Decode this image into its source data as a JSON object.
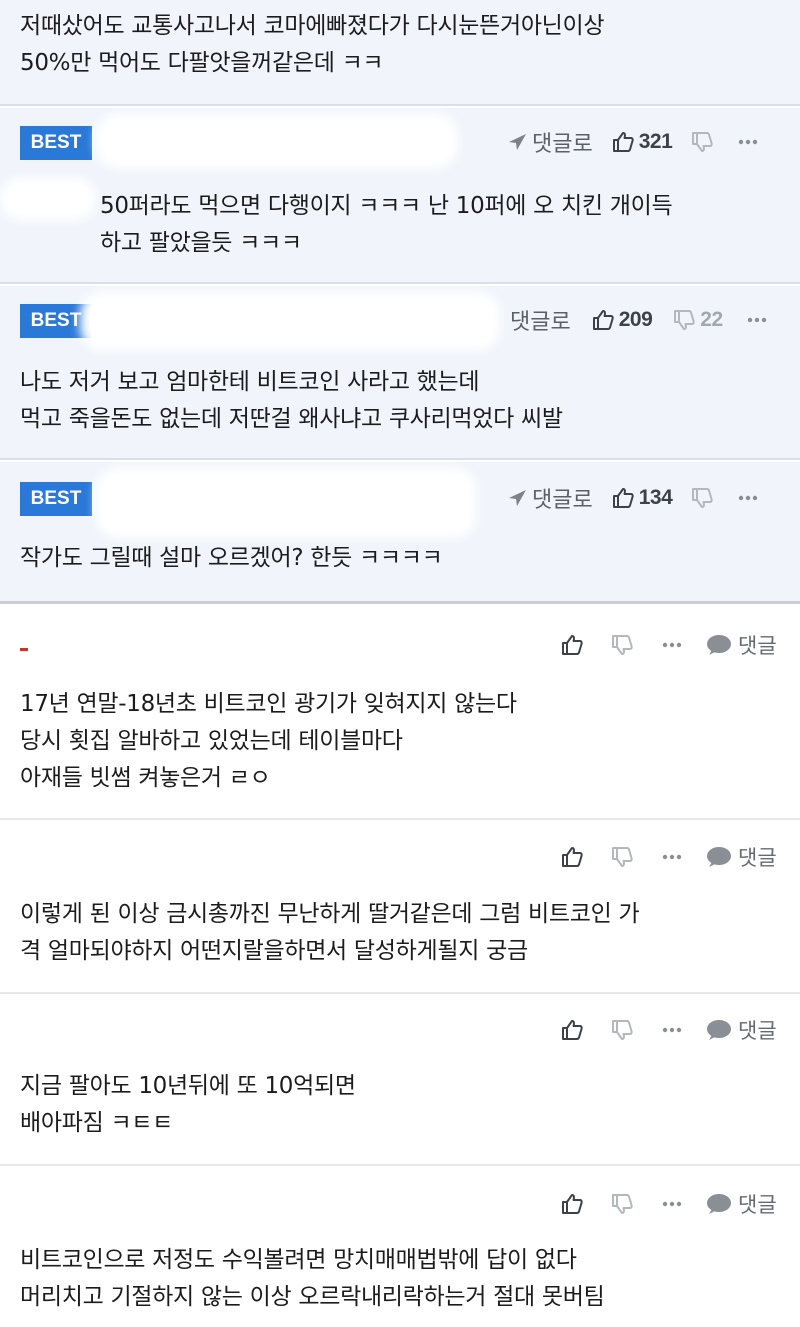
{
  "top_comment": {
    "text": "저때샀어도 교통사고나서 코마에빠졌다가 다시눈뜬거아닌이상\n50%만 먹어도 다팔앗을꺼같은데 ㅋㅋ"
  },
  "best_comments": [
    {
      "badge": "BEST",
      "reply_label": "댓글로",
      "likes": "321",
      "dislikes": "",
      "text": "50퍼라도 먹으면 다행이지 ㅋㅋㅋ 난 10퍼에 오 치킨 개이득\n하고 팔았을듯 ㅋㅋㅋ"
    },
    {
      "badge": "BEST",
      "reply_label": "댓글로",
      "likes": "209",
      "dislikes": "22",
      "text": "나도 저거 보고 엄마한테 비트코인 사라고 했는데\n먹고 죽을돈도 없는데 저딴걸 왜사냐고 쿠사리먹었다 씨발"
    },
    {
      "badge": "BEST",
      "reply_label": "댓글로",
      "likes": "134",
      "dislikes": "",
      "text": "작가도 그릴때 설마 오르겠어? 한듯 ㅋㅋㅋㅋ"
    }
  ],
  "comments": [
    {
      "reply_label": "댓글",
      "text": "17년 연말-18년초 비트코인 광기가 잊혀지지 않는다\n당시 횟집 알바하고 있었는데 테이블마다\n아재들 빗썸 켜놓은거 ㄹㅇ"
    },
    {
      "reply_label": "댓글",
      "text": "이렇게 된 이상 금시총까진 무난하게 딸거같은데 그럼 비트코인 가\n격 얼마되야하지 어떤지랄을하면서 달성하게될지 궁금"
    },
    {
      "reply_label": "댓글",
      "text": "지금 팔아도 10년뒤에 또 10억되면\n배아파짐 ㅋㅌㅌ"
    },
    {
      "reply_label": "댓글",
      "text": "비트코인으로 저정도 수익볼려면 망치매매법밖에 답이 없다\n머리치고 기절하지 않는 이상 오르락내리락하는거 절대 못버팀"
    }
  ],
  "colors": {
    "best_bg": "#f1f5fb",
    "badge_blue": "#2a78d8",
    "icon_gray": "#5b5f66",
    "muted_gray": "#a3a8b0"
  },
  "icons": [
    "share-arrow-icon",
    "thumbs-up-icon",
    "thumbs-down-icon",
    "more-dots-icon",
    "speech-bubble-icon"
  ]
}
